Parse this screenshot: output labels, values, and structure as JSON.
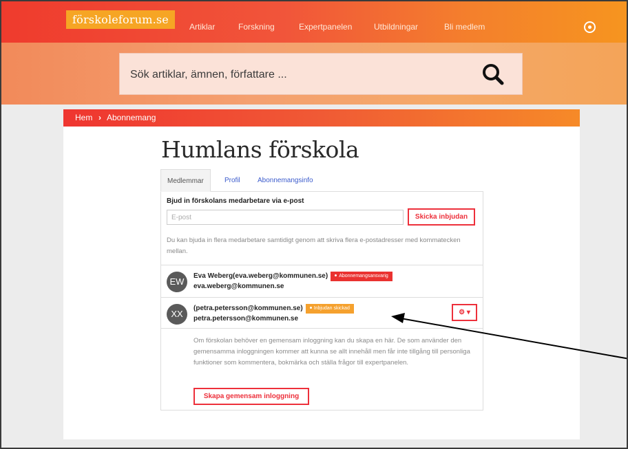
{
  "nav": {
    "logo": "förskoleforum.se",
    "links": [
      "Artiklar",
      "Forskning",
      "Expertpanelen",
      "Utbildningar",
      "Bli medlem"
    ],
    "user_icon": "user-circle-icon"
  },
  "search": {
    "placeholder": "Sök artiklar, ämnen, författare ...",
    "icon": "search-icon"
  },
  "breadcrumb": {
    "home": "Hem",
    "separator": "›",
    "current": "Abonnemang"
  },
  "page": {
    "title": "Humlans förskola"
  },
  "tabs": [
    "Medlemmar",
    "Profil",
    "Abonnemangsinfo"
  ],
  "invite": {
    "title": "Bjud in förskolans medarbetare via e-post",
    "placeholder": "E-post",
    "button": "Skicka inbjudan",
    "hint": "Du kan bjuda in flera medarbetare samtidigt genom att skriva flera e-postadresser med kommatecken mellan."
  },
  "members": [
    {
      "initials": "EW",
      "name": "Eva Weberg(eva.weberg@kommunen.se)",
      "email": "eva.weberg@kommunen.se",
      "badge": "Abonnemangsansvarig"
    },
    {
      "initials": "XX",
      "name": "(petra.petersson@kommunen.se)",
      "email": "petra.petersson@kommunen.se",
      "badge": "Inbjudan skickad",
      "action": "⚙ ▾"
    }
  ],
  "shared_login": {
    "text": "Om förskolan behöver en gemensam inloggning kan du skapa en här. De som använder den gemensamma inloggningen kommer att kunna se allt innehåll men får inte tillgång till personliga funktioner som kommentera, bokmärka och ställa frågor till expertpanelen.",
    "button": "Skapa gemensam inloggning"
  },
  "colors": {
    "accent_red": "#ed2f3a",
    "accent_orange": "#f5a12e",
    "link_blue": "#3b5bcc"
  }
}
